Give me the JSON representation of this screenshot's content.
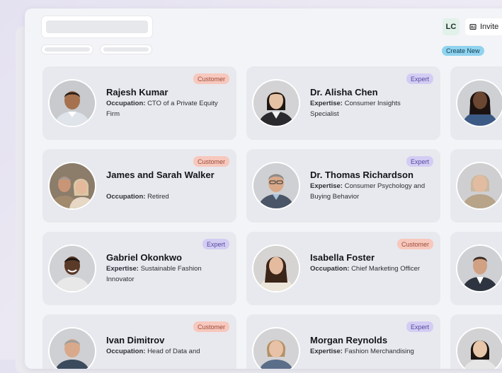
{
  "header": {
    "avatar_initials": "LC",
    "invite_label": "Invite",
    "create_new_label": "Create New"
  },
  "cards": [
    {
      "name": "Rajesh Kumar",
      "badge": "Customer",
      "field_label": "Occupation:",
      "field_value": "CTO of a Private Equity Firm"
    },
    {
      "name": "Dr. Alisha Chen",
      "badge": "Expert",
      "field_label": "Expertise:",
      "field_value": "Consumer Insights Specialist"
    },
    {
      "name": "James and Sarah Walker",
      "badge": "Customer",
      "field_label": "Occupation:",
      "field_value": "Retired"
    },
    {
      "name": "Dr. Thomas Richardson",
      "badge": "Expert",
      "field_label": "Expertise:",
      "field_value": "Consumer Psychology and Buying Behavior"
    },
    {
      "name": "Gabriel Okonkwo",
      "badge": "Expert",
      "field_label": "Expertise:",
      "field_value": "Sustainable Fashion Innovator"
    },
    {
      "name": "Isabella Foster",
      "badge": "Customer",
      "field_label": "Occupation:",
      "field_value": "Chief Marketing Officer"
    },
    {
      "name": "Ivan Dimitrov",
      "badge": "Customer",
      "field_label": "Occupation:",
      "field_value": "Head of Data and"
    },
    {
      "name": "Morgan Reynolds",
      "badge": "Expert",
      "field_label": "Expertise:",
      "field_value": "Fashion Merchandising"
    }
  ],
  "colors": {
    "customer_badge": "#f7c8bd",
    "expert_badge": "#d3cdf4",
    "create_new": "#8fd3ef",
    "avatar_bg": "#e2f1ea"
  }
}
